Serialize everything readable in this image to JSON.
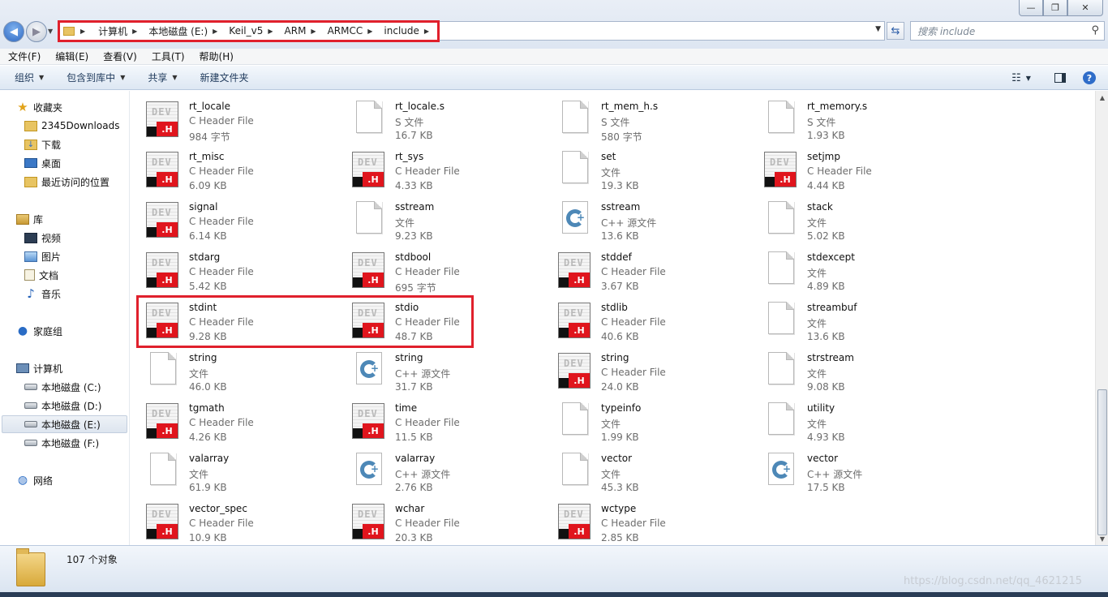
{
  "window": {
    "controls": {
      "minimize": "—",
      "maximize": "❐",
      "close": "✕"
    }
  },
  "address": {
    "breadcrumbs": [
      "计算机",
      "本地磁盘 (E:)",
      "Keil_v5",
      "ARM",
      "ARMCC",
      "include"
    ]
  },
  "search": {
    "placeholder": "搜索 include"
  },
  "menu": [
    "文件(F)",
    "编辑(E)",
    "查看(V)",
    "工具(T)",
    "帮助(H)"
  ],
  "toolbar": {
    "organize": "组织",
    "include_in_library": "包含到库中",
    "share": "共享",
    "new_folder": "新建文件夹"
  },
  "sidebar": {
    "favorites": "收藏夹",
    "fav_items": [
      "2345Downloads",
      "下载",
      "桌面",
      "最近访问的位置"
    ],
    "libraries": "库",
    "lib_items": [
      "视频",
      "图片",
      "文档",
      "音乐"
    ],
    "homegroup": "家庭组",
    "computer": "计算机",
    "drives": [
      "本地磁盘 (C:)",
      "本地磁盘 (D:)",
      "本地磁盘 (E:)",
      "本地磁盘 (F:)"
    ],
    "network": "网络"
  },
  "files": [
    {
      "name": "rt_locale",
      "type": "C Header File",
      "size": "984 字节",
      "icon": "h"
    },
    {
      "name": "rt_locale.s",
      "type": "S 文件",
      "size": "16.7 KB",
      "icon": "blank"
    },
    {
      "name": "rt_mem_h.s",
      "type": "S 文件",
      "size": "580 字节",
      "icon": "blank"
    },
    {
      "name": "rt_memory.s",
      "type": "S 文件",
      "size": "1.93 KB",
      "icon": "blank"
    },
    {
      "name": "rt_misc",
      "type": "C Header File",
      "size": "6.09 KB",
      "icon": "h"
    },
    {
      "name": "rt_sys",
      "type": "C Header File",
      "size": "4.33 KB",
      "icon": "h"
    },
    {
      "name": "set",
      "type": "文件",
      "size": "19.3 KB",
      "icon": "blank"
    },
    {
      "name": "setjmp",
      "type": "C Header File",
      "size": "4.44 KB",
      "icon": "h"
    },
    {
      "name": "signal",
      "type": "C Header File",
      "size": "6.14 KB",
      "icon": "h"
    },
    {
      "name": "sstream",
      "type": "文件",
      "size": "9.23 KB",
      "icon": "blank"
    },
    {
      "name": "sstream",
      "type": "C++ 源文件",
      "size": "13.6 KB",
      "icon": "cpp"
    },
    {
      "name": "stack",
      "type": "文件",
      "size": "5.02 KB",
      "icon": "blank"
    },
    {
      "name": "stdarg",
      "type": "C Header File",
      "size": "5.42 KB",
      "icon": "h"
    },
    {
      "name": "stdbool",
      "type": "C Header File",
      "size": "695 字节",
      "icon": "h"
    },
    {
      "name": "stddef",
      "type": "C Header File",
      "size": "3.67 KB",
      "icon": "h"
    },
    {
      "name": "stdexcept",
      "type": "文件",
      "size": "4.89 KB",
      "icon": "blank"
    },
    {
      "name": "stdint",
      "type": "C Header File",
      "size": "9.28 KB",
      "icon": "h"
    },
    {
      "name": "stdio",
      "type": "C Header File",
      "size": "48.7 KB",
      "icon": "h"
    },
    {
      "name": "stdlib",
      "type": "C Header File",
      "size": "40.6 KB",
      "icon": "h"
    },
    {
      "name": "streambuf",
      "type": "文件",
      "size": "13.6 KB",
      "icon": "blank"
    },
    {
      "name": "string",
      "type": "文件",
      "size": "46.0 KB",
      "icon": "blank"
    },
    {
      "name": "string",
      "type": "C++ 源文件",
      "size": "31.7 KB",
      "icon": "cpp"
    },
    {
      "name": "string",
      "type": "C Header File",
      "size": "24.0 KB",
      "icon": "h"
    },
    {
      "name": "strstream",
      "type": "文件",
      "size": "9.08 KB",
      "icon": "blank"
    },
    {
      "name": "tgmath",
      "type": "C Header File",
      "size": "4.26 KB",
      "icon": "h"
    },
    {
      "name": "time",
      "type": "C Header File",
      "size": "11.5 KB",
      "icon": "h"
    },
    {
      "name": "typeinfo",
      "type": "文件",
      "size": "1.99 KB",
      "icon": "blank"
    },
    {
      "name": "utility",
      "type": "文件",
      "size": "4.93 KB",
      "icon": "blank"
    },
    {
      "name": "valarray",
      "type": "文件",
      "size": "61.9 KB",
      "icon": "blank"
    },
    {
      "name": "valarray",
      "type": "C++ 源文件",
      "size": "2.76 KB",
      "icon": "cpp"
    },
    {
      "name": "vector",
      "type": "文件",
      "size": "45.3 KB",
      "icon": "blank"
    },
    {
      "name": "vector",
      "type": "C++ 源文件",
      "size": "17.5 KB",
      "icon": "cpp"
    },
    {
      "name": "vector_spec",
      "type": "C Header File",
      "size": "10.9 KB",
      "icon": "h"
    },
    {
      "name": "wchar",
      "type": "C Header File",
      "size": "20.3 KB",
      "icon": "h"
    },
    {
      "name": "wctype",
      "type": "C Header File",
      "size": "2.85 KB",
      "icon": "h"
    }
  ],
  "status": {
    "count": "107 个对象"
  },
  "watermark": "https://blog.csdn.net/qq_4621215"
}
